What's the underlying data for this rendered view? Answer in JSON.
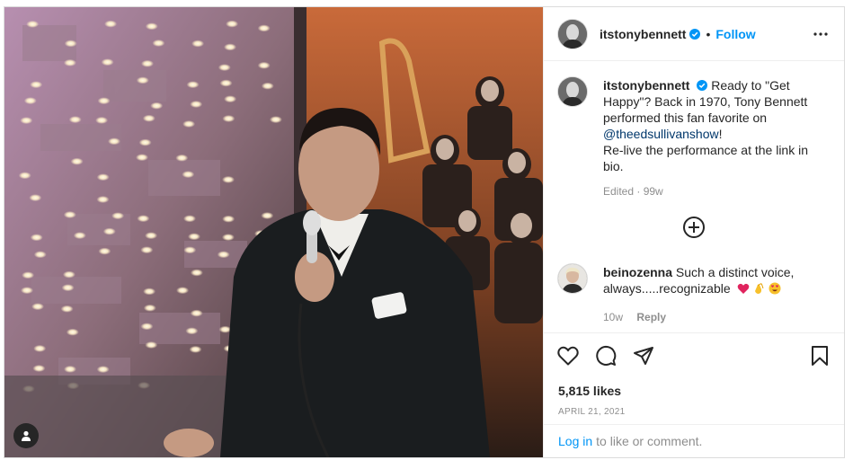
{
  "post": {
    "username": "itstonybennett",
    "follow_label": "Follow",
    "dot": "•",
    "caption": {
      "text_before_mention": "Ready to \"Get Happy\"? Back in 1970, Tony Bennett performed this fan favorite on",
      "mention": "@theedsullivanshow",
      "text_after_mention": "!",
      "text_line2": "Re-live the performance at the link in bio.",
      "meta": "Edited · 99w"
    },
    "comment": {
      "username": "beinozenna",
      "text": "Such a distinct voice, always.....recognizable",
      "emojis": [
        "red-heart",
        "clapping-hands",
        "heart-eyes-face"
      ],
      "time": "10w",
      "reply_label": "Reply"
    },
    "likes": "5,815 likes",
    "date": "APRIL 21, 2021",
    "login_link": "Log in",
    "login_rest": "to like or comment."
  },
  "colors": {
    "accent": "#0095f6",
    "mention": "#00376b",
    "muted": "#8e8e8e",
    "heart": "#ed4956"
  },
  "icons": {
    "verified": "verified-badge-icon",
    "more": "more-options-icon",
    "load_more": "plus-circle-icon",
    "like": "heart-icon",
    "comment": "comment-bubble-icon",
    "share": "paper-plane-icon",
    "save": "bookmark-icon",
    "user_tag": "user-tag-icon"
  }
}
